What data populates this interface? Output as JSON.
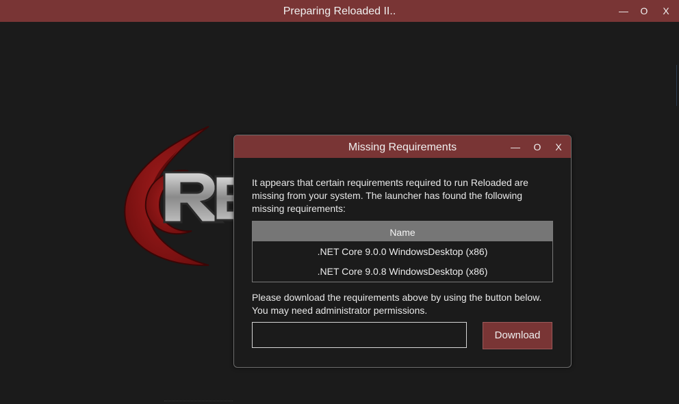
{
  "main_window": {
    "title": "Preparing Reloaded II..",
    "controls": {
      "minimize": "—",
      "maximize": "O",
      "close": "X"
    }
  },
  "logo": {
    "icon": "reloaded-logo-icon",
    "accent_color": "#8b1a1a"
  },
  "dialog": {
    "title": "Missing Requirements",
    "controls": {
      "minimize": "—",
      "maximize": "O",
      "close": "X"
    },
    "intro_text": "It appears that certain requirements required to run Reloaded are missing from your system. The launcher has found the following missing requirements:",
    "table": {
      "header": "Name",
      "rows": [
        ".NET Core 9.0.0 WindowsDesktop (x86)",
        ".NET Core 9.0.8 WindowsDesktop (x86)"
      ]
    },
    "outro_text": "Please download the requirements above by using the button below. You may need administrator permissions.",
    "input_value": "",
    "download_label": "Download"
  },
  "colors": {
    "titlebar": "#793535",
    "background": "#1b1b1b",
    "table_header": "#767676"
  }
}
